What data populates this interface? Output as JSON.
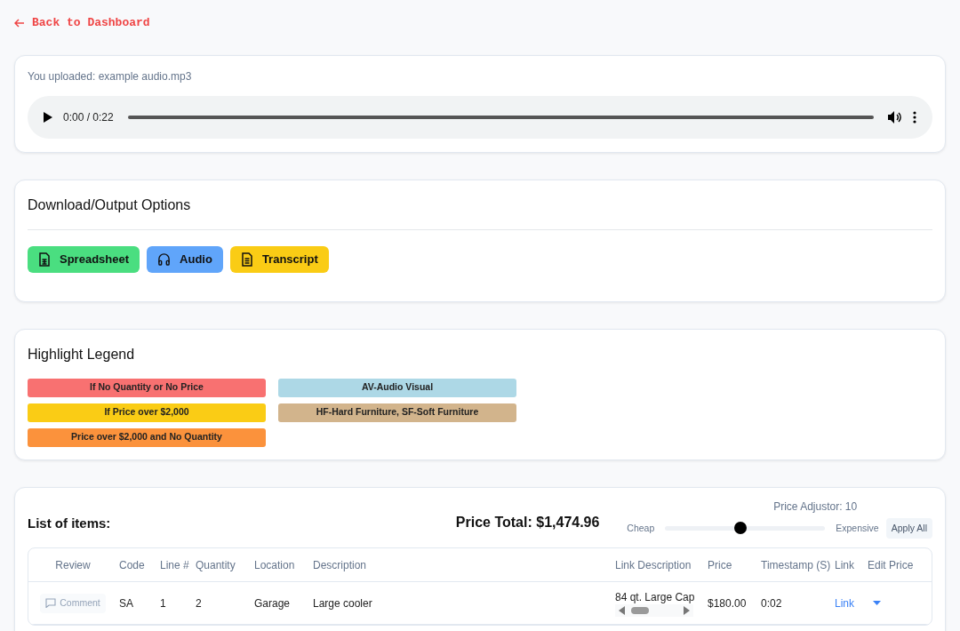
{
  "back_link": {
    "label": "Back to Dashboard"
  },
  "upload": {
    "label": "You uploaded: example audio.mp3",
    "player": {
      "time": "0:00 / 0:22",
      "level": 0
    }
  },
  "download": {
    "title": "Download/Output Options",
    "buttons": [
      {
        "label": "Spreadsheet",
        "kind": "spreadsheet",
        "color": "#4ade80"
      },
      {
        "label": "Audio",
        "kind": "audio",
        "color": "#60a5fa"
      },
      {
        "label": "Transcript",
        "kind": "transcript",
        "color": "#facc15"
      }
    ]
  },
  "legend": {
    "title": "Highlight Legend",
    "items": [
      {
        "label": "If No Quantity or No Price",
        "color": "#f87171"
      },
      {
        "label": "AV-Audio Visual",
        "color": "#add8e6"
      },
      {
        "label": "If Price over $2,000",
        "color": "#facc15"
      },
      {
        "label": "HF-Hard Furniture, SF-Soft Furniture",
        "color": "#d2b48c"
      },
      {
        "label": "Price over $2,000 and No Quantity",
        "color": "#fb923c"
      }
    ]
  },
  "items": {
    "title": "List of items:",
    "total": "Price Total: $1,474.96",
    "adjustor": {
      "label": "Price Adjustor: 10",
      "min_label": "Cheap",
      "max_label": "Expensive",
      "level": 0.47,
      "apply": "Apply All"
    },
    "table": {
      "columns": [
        "Review",
        "Code",
        "Line #",
        "Quantity",
        "Location",
        "Description",
        "Link Description",
        "Price",
        "Timestamp (S)",
        "Link",
        "Edit Price"
      ],
      "rows": [
        {
          "review": "Comment",
          "code": "SA",
          "line": "1",
          "quantity": "2",
          "location": "Garage",
          "description": "Large cooler",
          "link_description": "84 qt. Large Cap",
          "price": "$180.00",
          "timestamp": "0:02",
          "link": "Link"
        }
      ]
    }
  }
}
